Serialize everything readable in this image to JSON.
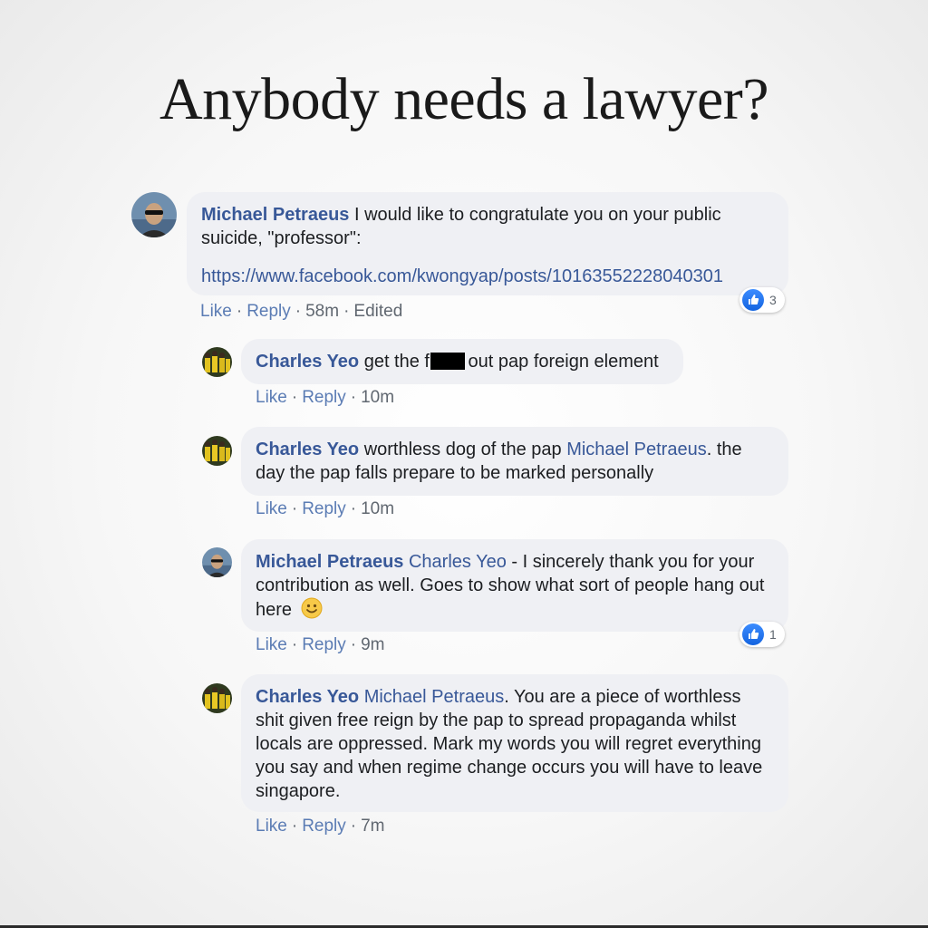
{
  "title": "Anybody needs a lawyer?",
  "comments": [
    {
      "author": "Michael Petraeus",
      "text": " I would like to congratulate you on your public suicide, \"professor\":",
      "link": "https://www.facebook.com/kwongyap/posts/10163552228040301",
      "actions": {
        "like": "Like",
        "reply": "Reply",
        "time": "58m",
        "edited": "Edited"
      },
      "reactions": "3"
    },
    {
      "author": "Charles Yeo",
      "text_before": " get the f",
      "text_after": " out pap foreign element",
      "actions": {
        "like": "Like",
        "reply": "Reply",
        "time": "10m"
      }
    },
    {
      "author": "Charles Yeo",
      "text_before": " worthless dog of the pap ",
      "mention": "Michael Petraeus",
      "text_after": ". the day the pap falls prepare to be marked personally",
      "actions": {
        "like": "Like",
        "reply": "Reply",
        "time": "10m"
      }
    },
    {
      "author": "Michael Petraeus",
      "mention": " Charles Yeo",
      "text_after": " - I sincerely thank you for your contribution as well. Goes to show what sort of people hang out here",
      "emoji": "smiley-icon",
      "actions": {
        "like": "Like",
        "reply": "Reply",
        "time": "9m"
      },
      "reactions": "1"
    },
    {
      "author": "Charles Yeo",
      "mention": " Michael Petraeus",
      "text_after": ". You are a piece of worthless shit given free reign by the pap to spread propaganda whilst locals are oppressed. Mark my words you will regret everything you say and when regime change occurs you will have to leave singapore.",
      "actions": {
        "like": "Like",
        "reply": "Reply",
        "time": "7m"
      }
    }
  ],
  "colors": {
    "link": "#385898",
    "bubble": "#eff0f4",
    "like_badge": "#1877f2"
  }
}
